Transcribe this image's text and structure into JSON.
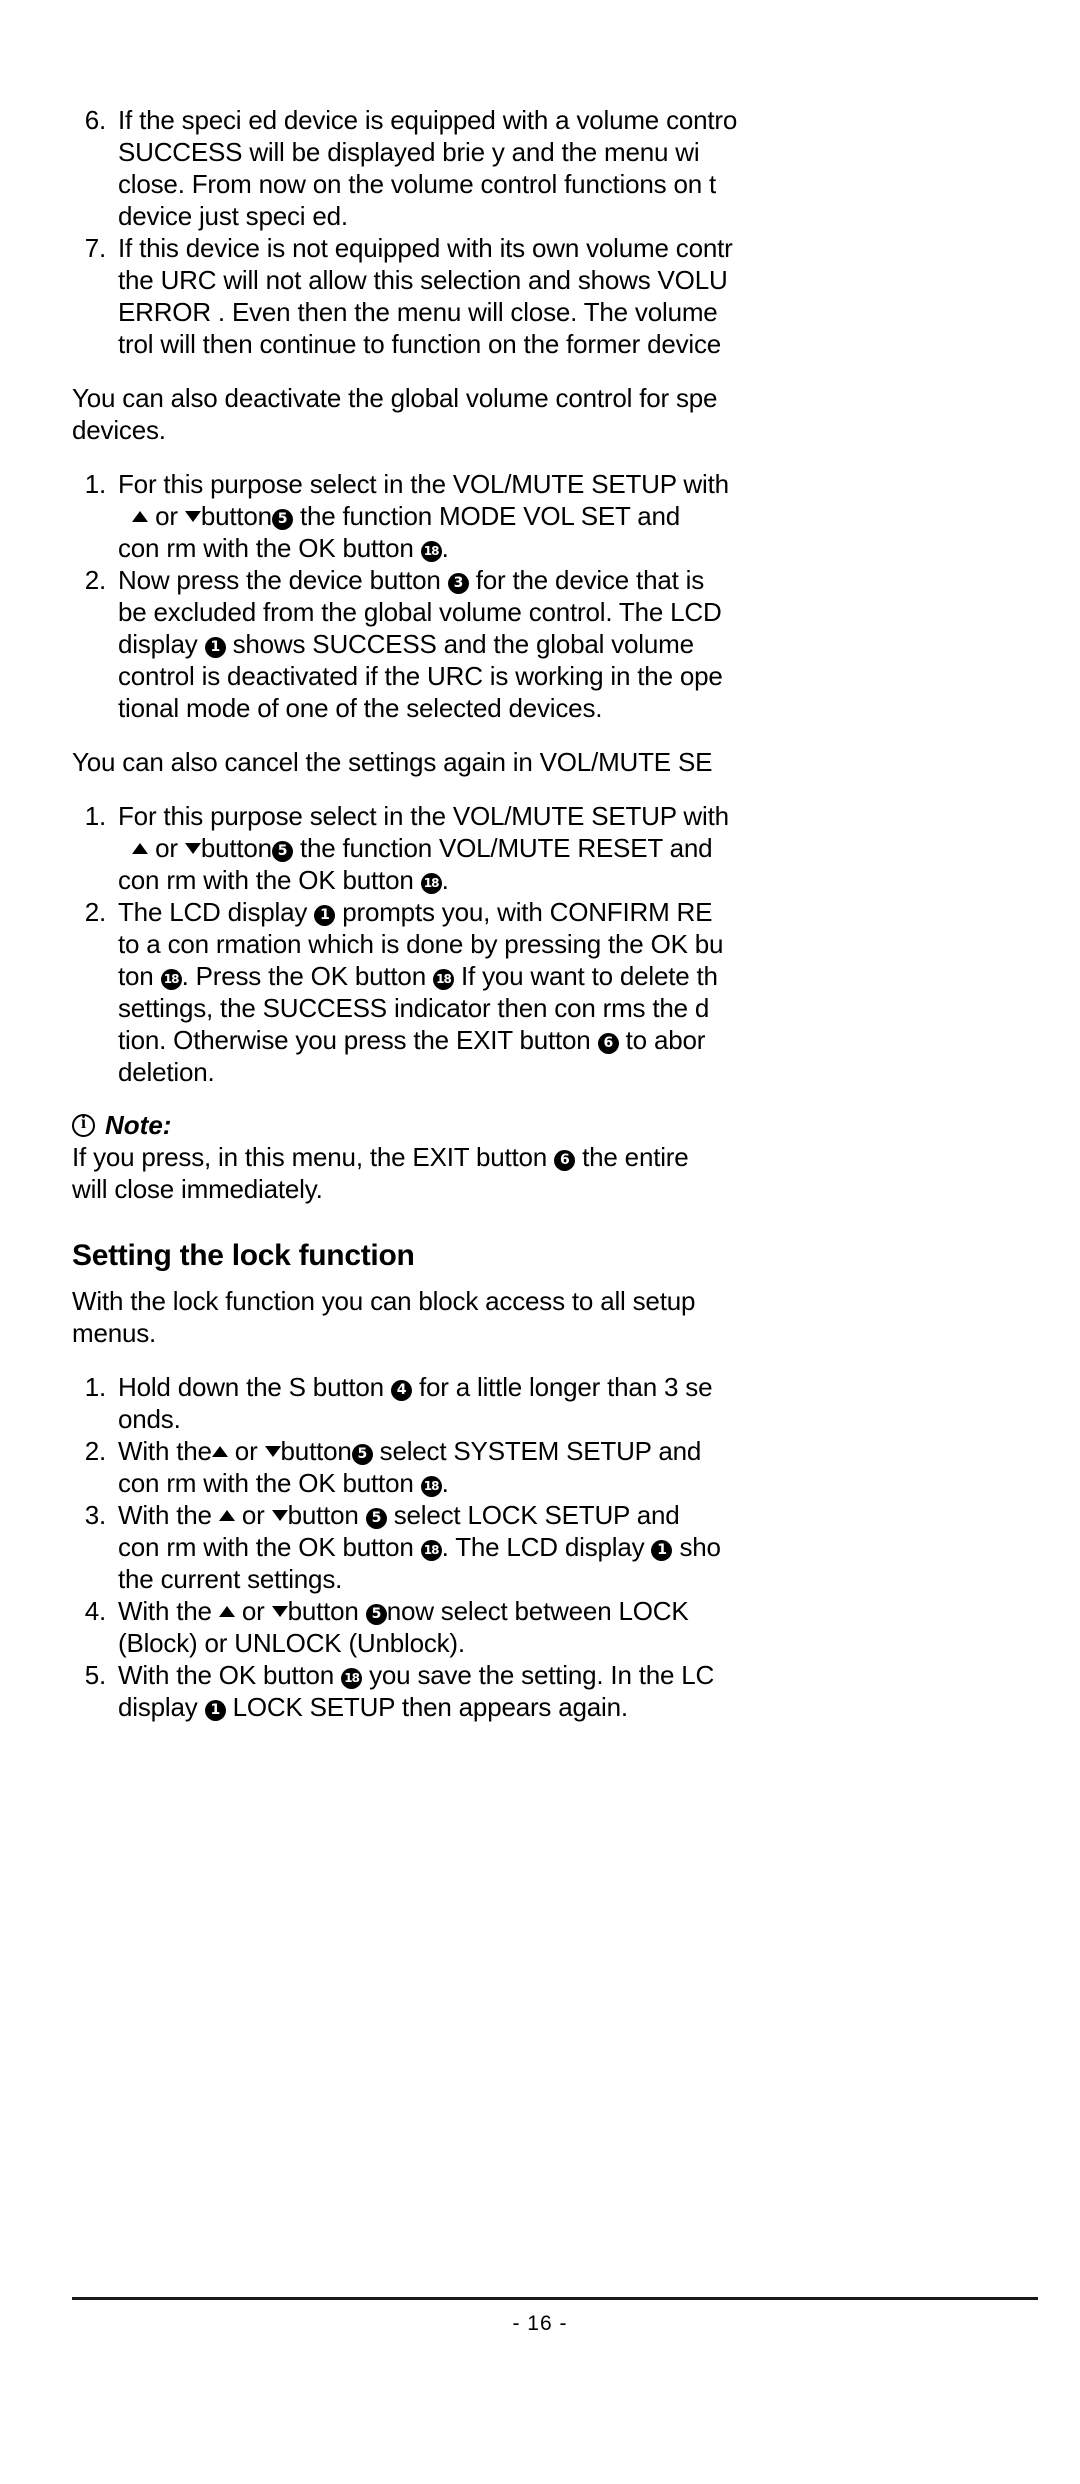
{
  "page": {
    "number_label": "- 16 -",
    "page_number": 16
  },
  "icons": {
    "info": "info-circle-icon",
    "up": "triangle-up-icon",
    "down": "triangle-down-icon"
  },
  "refs": {
    "lcd_display": "1",
    "device_button": "3",
    "s_button": "4",
    "updown_button": "5",
    "exit_button": "6",
    "ok_button": "18"
  },
  "blocks": {
    "step6": {
      "num": "6.",
      "lines": [
        "If the speci ed device is equipped with a volume contro",
        " SUCCESS  will be displayed brie y and the menu wi",
        "close. From now on the volume control functions on t",
        "device just speci ed."
      ]
    },
    "step7": {
      "num": "7.",
      "lines": [
        "If this device is not equipped with its own volume contr",
        "the URC will not allow this selection and shows  VOLU",
        "ERROR . Even then the menu will close. The volume",
        "trol will then continue to function on the former device"
      ]
    },
    "para_deactivate": {
      "lines": [
        "You can also deactivate the global volume control for spe",
        "devices."
      ]
    },
    "list_a": {
      "item1": {
        "num": "1.",
        "line1": "For this purpose select in the VOL/MUTE SETUP with",
        "line2_a": " or ",
        "line2_b": "button",
        "line2_c": " the function MODE VOL SET and",
        "line3_a": "con rm with the OK button ",
        "line3_b": "."
      },
      "item2": {
        "num": "2.",
        "line1_a": "Now press the device button ",
        "line1_b": " for the device that is ",
        "line2": "be excluded from the global volume control. The LCD",
        "line3_a": "display ",
        "line3_b": " shows  SUCCESS  and the global volume",
        "line4": "control is deactivated if the URC is working in the ope",
        "line5": "tional mode of one of the selected devices."
      }
    },
    "para_cancel": {
      "lines": [
        "You can also cancel the settings again in VOL/MUTE SE"
      ]
    },
    "list_b": {
      "item1": {
        "num": "1.",
        "line1": "For this purpose select in the VOL/MUTE SETUP with",
        "line2_a": " or ",
        "line2_b": "button",
        "line2_c": " the function VOL/MUTE RESET and",
        "line3_a": "con rm with the OK button ",
        "line3_b": "."
      },
      "item2": {
        "num": "2.",
        "line1_a": "The LCD display ",
        "line1_b": " prompts you, with CONFIRM RE",
        "line2": "to a con rmation which is done by pressing the OK bu",
        "line3_a": "ton ",
        "line3_b": ". Press the OK button ",
        "line3_c": " If you want to delete th",
        "line4": "settings, the SUCCESS indicator then con rms the d",
        "line5_a": "tion. Otherwise you press the EXIT button ",
        "line5_b": " to abor",
        "line6": "deletion."
      }
    },
    "note": {
      "label": "Note:",
      "line1_a": "If you press, in this menu, the EXIT button ",
      "line1_b": " the entire ",
      "line2": "will close immediately."
    },
    "lock_section": {
      "heading": "Setting the lock function",
      "intro_lines": [
        "With the lock function you can block access to all setup",
        "menus."
      ],
      "item1": {
        "num": "1.",
        "line1_a": "Hold down the S button ",
        "line1_b": " for a little longer than 3 se",
        "line2": "onds."
      },
      "item2": {
        "num": "2.",
        "line1_a": "With the",
        "line1_b": " or ",
        "line1_c": "button",
        "line1_d": " select  SYSTEM SETUP  and",
        "line2_a": "con rm with the OK button ",
        "line2_b": "."
      },
      "item3": {
        "num": "3.",
        "line1_a": "With the ",
        "line1_b": " or ",
        "line1_c": "button ",
        "line1_d": " select  LOCK SETUP and",
        "line2_a": "con rm with the OK button ",
        "line2_b": ". The LCD display ",
        "line2_c": " sho",
        "line3": "the current settings."
      },
      "item4": {
        "num": "4.",
        "line1_a": "With the ",
        "line1_b": " or ",
        "line1_c": "button ",
        "line1_d": "now select between  LOCK",
        "line2": "(Block) or  UNLOCK  (Unblock)."
      },
      "item5": {
        "num": "5.",
        "line1_a": "With the OK button ",
        "line1_b": " you save the setting. In the LC",
        "line2_a": "display ",
        "line2_b": "  LOCK SETUP  then appears again."
      }
    }
  }
}
